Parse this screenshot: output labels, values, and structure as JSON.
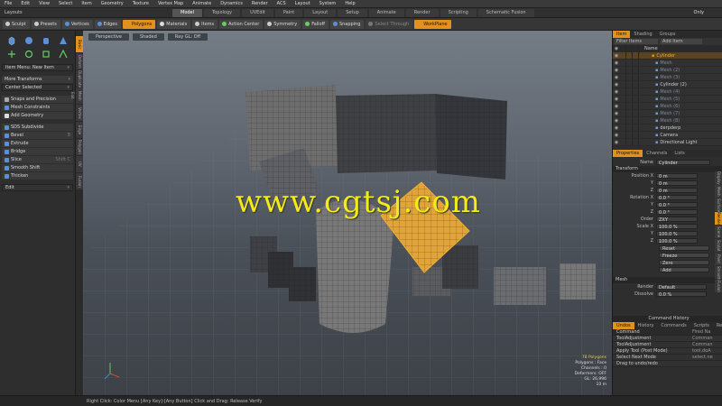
{
  "menubar": [
    "File",
    "Edit",
    "View",
    "Select",
    "Item",
    "Geometry",
    "Texture",
    "Vertex Map",
    "Animate",
    "Dynamics",
    "Render",
    "ACS",
    "Layout",
    "System",
    "Help"
  ],
  "menubar_right": "Only",
  "layouts": {
    "left": "Layouts",
    "tabs": [
      "Model",
      "Topology",
      "UVEdit",
      "Paint",
      "Layout",
      "Setup",
      "Animate",
      "Render",
      "Scripting",
      "Schematic Fusion"
    ],
    "active": "Model"
  },
  "toolbar": [
    {
      "label": "Sculpt",
      "style": "normal"
    },
    {
      "label": "Presets",
      "style": "normal"
    },
    {
      "label": "Vertices",
      "style": "normal"
    },
    {
      "label": "Edges",
      "style": "normal"
    },
    {
      "label": "Polygons",
      "style": "orange"
    },
    {
      "label": "Materials",
      "style": "normal"
    },
    {
      "label": "Items",
      "style": "normal"
    },
    {
      "label": "Action Center",
      "style": "normal"
    },
    {
      "label": "Symmetry",
      "style": "normal"
    },
    {
      "label": "Falloff",
      "style": "normal"
    },
    {
      "label": "Snapping",
      "style": "normal"
    },
    {
      "label": "Select Through",
      "style": "dim"
    },
    {
      "label": "WorkPlane",
      "style": "orange"
    }
  ],
  "left_panel": {
    "item_menu": "Item Menu: New Item",
    "more_transforms": "More Transforms",
    "center_selected": "Center Selected",
    "tools": [
      {
        "label": "Snaps and Precision",
        "color": "#aaa"
      },
      {
        "label": "Mesh Constraints",
        "color": "#5b8fd8"
      },
      {
        "label": "Add Geometry",
        "color": "#ddd"
      }
    ],
    "tools2": [
      {
        "label": "SDS Subdivide",
        "color": "#5b8fd8",
        "short": ""
      },
      {
        "label": "Bevel",
        "color": "#5b8fd8",
        "short": "B"
      },
      {
        "label": "Extrude",
        "color": "#5b8fd8",
        "short": ""
      },
      {
        "label": "Bridge",
        "color": "#5b8fd8",
        "short": ""
      },
      {
        "label": "Slice",
        "color": "#5b8fd8",
        "short": "Shift C"
      },
      {
        "label": "Smooth Shift",
        "color": "#5b8fd8",
        "short": ""
      },
      {
        "label": "Thicken",
        "color": "#5b8fd8",
        "short": ""
      }
    ],
    "edit": "Edit",
    "vtabs": [
      "Basic",
      "Deform",
      "Duplicate",
      "Mesh Edit",
      "Vertex",
      "Edge",
      "Polygon",
      "UV",
      "Fusion"
    ]
  },
  "viewport": {
    "tabs": [
      "Perspective",
      "Shaded",
      "Ray GL: Off"
    ],
    "watermark": "www.cgtsj.com",
    "stats": [
      "78 Polygons",
      "Polygons : Face",
      "Channels : 0",
      "Deformers: OFF",
      "GL: 26,996",
      "10 m"
    ]
  },
  "item_panel": {
    "tabs": [
      "Item",
      "Shading",
      "Groups"
    ],
    "filter": "Filter Items",
    "add_item": "Add Item",
    "col_name": "Name",
    "items": [
      {
        "name": "Cylinder",
        "sel": true,
        "dim": false
      },
      {
        "name": "Mesh",
        "sel": false,
        "dim": true
      },
      {
        "name": "Mesh (2)",
        "sel": false,
        "dim": true
      },
      {
        "name": "Mesh (3)",
        "sel": false,
        "dim": true
      },
      {
        "name": "Cylinder (2)",
        "sel": false,
        "dim": false
      },
      {
        "name": "Mesh (4)",
        "sel": false,
        "dim": true
      },
      {
        "name": "Mesh (5)",
        "sel": false,
        "dim": true
      },
      {
        "name": "Mesh (6)",
        "sel": false,
        "dim": true
      },
      {
        "name": "Mesh (7)",
        "sel": false,
        "dim": true
      },
      {
        "name": "Mesh (8)",
        "sel": false,
        "dim": true
      },
      {
        "name": "derpderp",
        "sel": false,
        "dim": false
      },
      {
        "name": "Camera",
        "sel": false,
        "dim": false
      },
      {
        "name": "Directional Light",
        "sel": false,
        "dim": false
      }
    ]
  },
  "properties": {
    "tabs": [
      "Properties",
      "Channels",
      "Lists"
    ],
    "name_label": "Name",
    "name_value": "Cylinder",
    "transform": "Transform",
    "rows": [
      {
        "label": "Position X",
        "value": "0 m"
      },
      {
        "label": "Y",
        "value": "0 m"
      },
      {
        "label": "Z",
        "value": "0 m"
      },
      {
        "label": "Rotation X",
        "value": "0.0 °"
      },
      {
        "label": "Y",
        "value": "0.0 °"
      },
      {
        "label": "Z",
        "value": "0.0 °"
      },
      {
        "label": "Order",
        "value": "ZXY"
      },
      {
        "label": "Scale X",
        "value": "100.0 %"
      },
      {
        "label": "Y",
        "value": "100.0 %"
      },
      {
        "label": "Z",
        "value": "100.0 %"
      }
    ],
    "buttons": [
      "Reset",
      "Freeze",
      "Zero",
      "Add"
    ],
    "mesh": "Mesh",
    "render_label": "Render",
    "render_value": "Default",
    "dissolve_label": "Dissolve",
    "dissolve_value": "0.0 %",
    "rvtabs": [
      "Display",
      "Mesh",
      "Surface",
      "Render",
      "Scene",
      "Sculpt",
      "Paint",
      "Smooth",
      "Fusion"
    ]
  },
  "command_history": {
    "title": "Command History",
    "tabs": [
      "Undos",
      "History",
      "Commands",
      "Scripts",
      "Results"
    ],
    "col_command": "Command",
    "col_fired": "Fired Na",
    "rows": [
      {
        "cmd": "ToolAdjustment",
        "fired": "Comman"
      },
      {
        "cmd": "ToolAdjustment",
        "fired": "Comman"
      },
      {
        "cmd": "Apply Tool (Post Mode)",
        "fired": "tool.doA"
      },
      {
        "cmd": "Select Next Mode",
        "fired": "select.ne"
      },
      {
        "cmd": "Drag to undo/redo",
        "fired": ""
      }
    ]
  },
  "statusbar": "Right Click: Color Menu  [Any Key]-[Any Button] Click and Drag: Release Verify"
}
